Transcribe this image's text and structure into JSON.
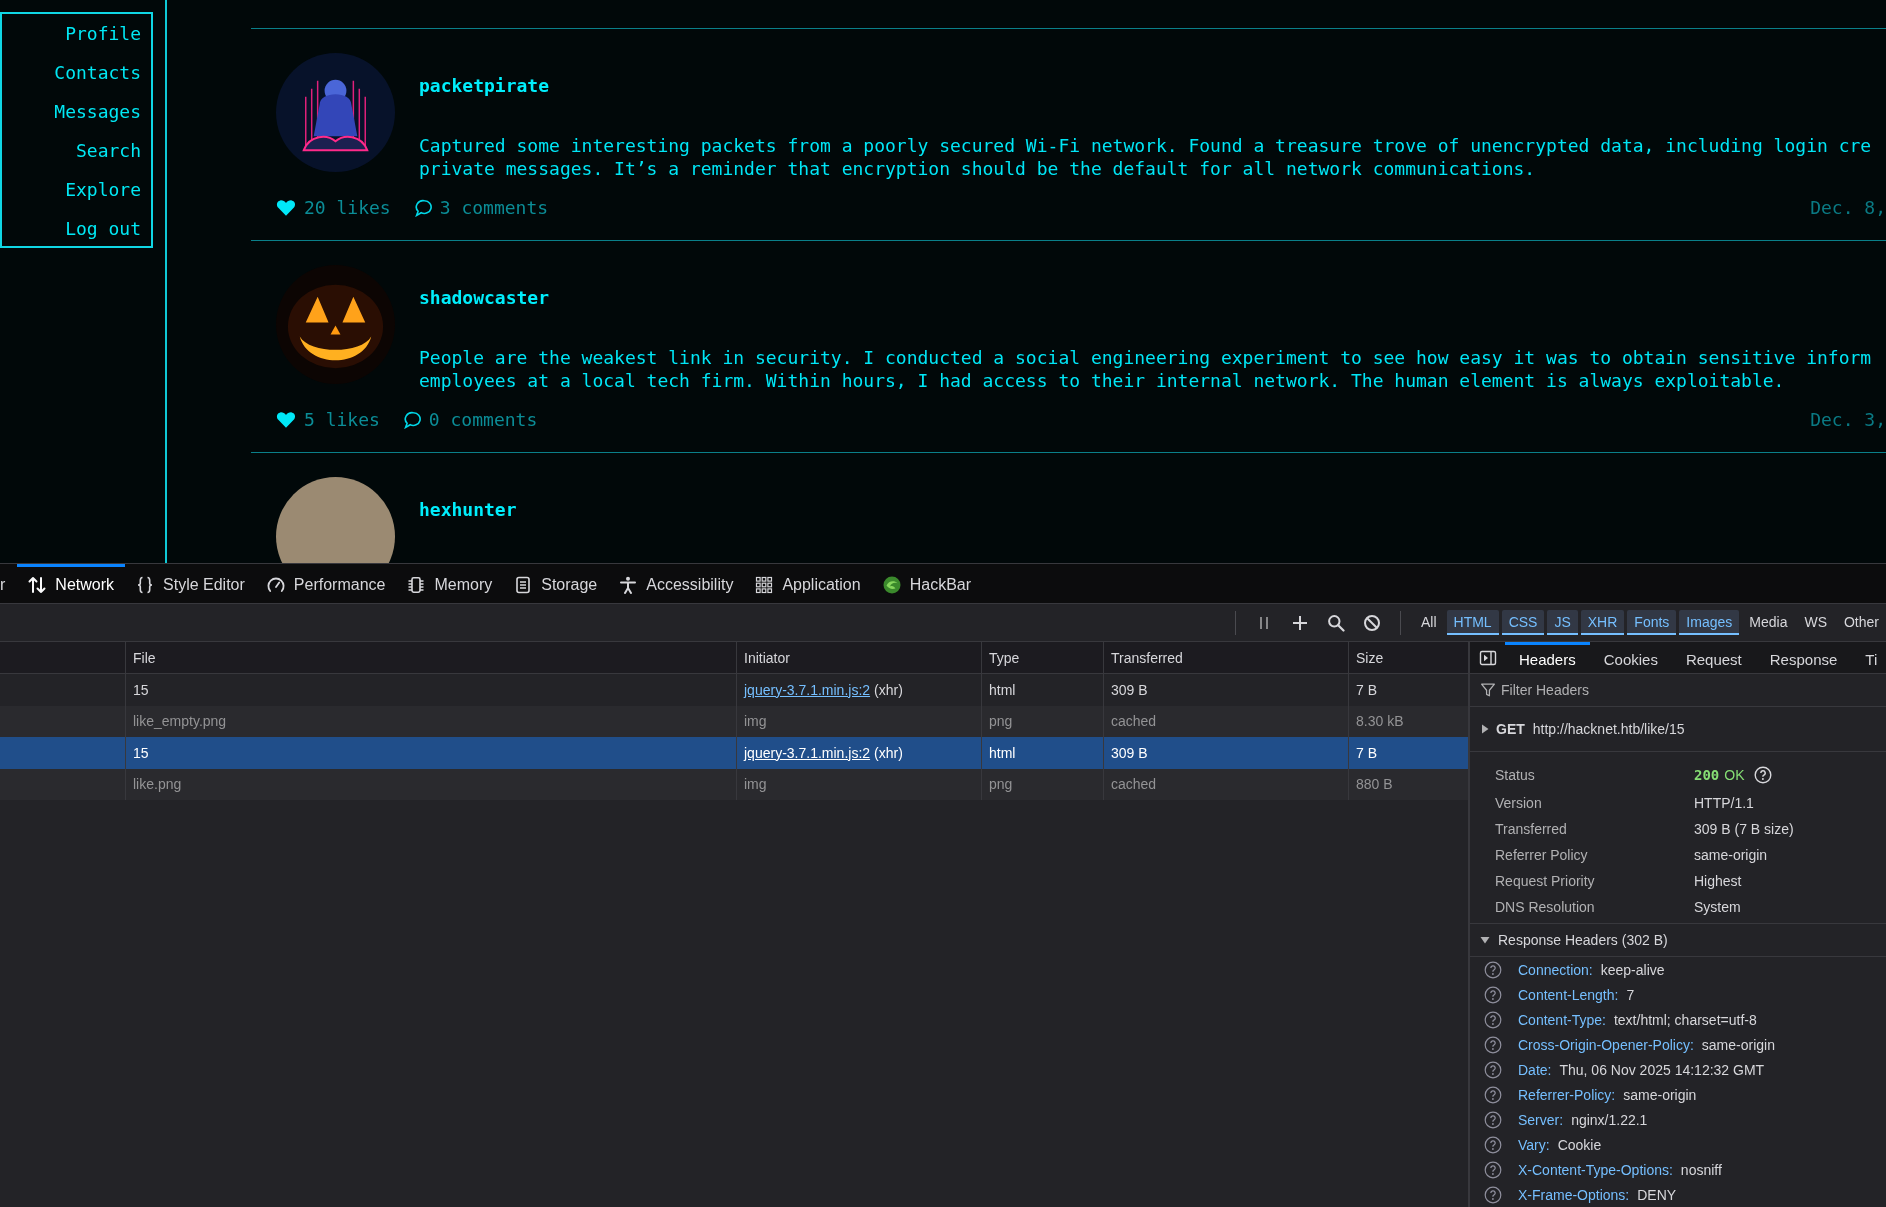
{
  "sidebar": {
    "items": [
      "Profile",
      "Contacts",
      "Messages",
      "Search",
      "Explore",
      "Log out"
    ]
  },
  "feed": {
    "posts": [
      {
        "avatar": {
          "kind": "silhouette"
        },
        "username": "packetpirate",
        "body": "Captured some interesting packets from a poorly secured Wi-Fi network. Found a treasure trove of unencrypted data, including login cre\nprivate messages. It’s a reminder that encryption should be the default for all network communications.",
        "likes": "20 likes",
        "comments": "3 comments",
        "date": "Dec. 8,"
      },
      {
        "avatar": {
          "kind": "pumpkin"
        },
        "username": "shadowcaster",
        "body": "People are the weakest link in security. I conducted a social engineering experiment to see how easy it was to obtain sensitive inform\nemployees at a local tech firm. Within hours, I had access to their internal network. The human element is always exploitable.",
        "likes": "5 likes",
        "comments": "0 comments",
        "date": "Dec. 3,"
      },
      {
        "avatar": {
          "kind": "photo"
        },
        "username": "hexhunter"
      }
    ]
  },
  "devtools": {
    "tabs": [
      {
        "kind": "plain",
        "label": "r",
        "selected": false
      },
      {
        "kind": "network",
        "label": "Network",
        "selected": true
      },
      {
        "kind": "styles",
        "label": "Style Editor",
        "selected": false
      },
      {
        "kind": "performance",
        "label": "Performance",
        "selected": false
      },
      {
        "kind": "memory",
        "label": "Memory",
        "selected": false
      },
      {
        "kind": "storage",
        "label": "Storage",
        "selected": false
      },
      {
        "kind": "accessibility",
        "label": "Accessibility",
        "selected": false
      },
      {
        "kind": "application",
        "label": "Application",
        "selected": false
      },
      {
        "kind": "addon",
        "label": "HackBar",
        "selected": false
      }
    ],
    "toolbar": {
      "filters": [
        {
          "label": "All",
          "selected": false
        },
        {
          "label": "HTML",
          "selected": true
        },
        {
          "label": "CSS",
          "selected": true
        },
        {
          "label": "JS",
          "selected": true
        },
        {
          "label": "XHR",
          "selected": true
        },
        {
          "label": "Fonts",
          "selected": true
        },
        {
          "label": "Images",
          "selected": true
        },
        {
          "label": "Media",
          "selected": false
        },
        {
          "label": "WS",
          "selected": false
        },
        {
          "label": "Other",
          "selected": false
        }
      ]
    },
    "requests": {
      "columns": [
        "File",
        "Initiator",
        "Type",
        "Transferred",
        "Size"
      ],
      "rows": [
        {
          "file": "15",
          "initiator": {
            "link": "jquery-3.7.1.min.js:2",
            "text": "(xhr)"
          },
          "type": "html",
          "transferred": "309 B",
          "size": "7 B",
          "cached": false,
          "selected": false
        },
        {
          "file": "like_empty.png",
          "initiator": {
            "text": "img"
          },
          "type": "png",
          "transferred": "cached",
          "size": "8.30 kB",
          "cached": true,
          "selected": false
        },
        {
          "file": "15",
          "initiator": {
            "link": "jquery-3.7.1.min.js:2",
            "text": "(xhr)"
          },
          "type": "html",
          "transferred": "309 B",
          "size": "7 B",
          "cached": false,
          "selected": true
        },
        {
          "file": "like.png",
          "initiator": {
            "text": "img"
          },
          "type": "png",
          "transferred": "cached",
          "size": "880 B",
          "cached": true,
          "selected": false
        }
      ]
    },
    "details": {
      "tabs": [
        {
          "label": "Headers",
          "selected": true
        },
        {
          "label": "Cookies",
          "selected": false
        },
        {
          "label": "Request",
          "selected": false
        },
        {
          "label": "Response",
          "selected": false
        },
        {
          "label": "Ti",
          "selected": false
        }
      ],
      "filter": {
        "placeholder": "Filter Headers"
      },
      "request": {
        "method": "GET",
        "url": "http://hacknet.htb/like/15",
        "expanded": false
      },
      "summary": [
        {
          "kind": "status",
          "label": "Status",
          "code": "200",
          "text": "OK"
        },
        {
          "kind": "text",
          "label": "Version",
          "value": "HTTP/1.1"
        },
        {
          "kind": "text",
          "label": "Transferred",
          "value": "309 B (7 B size)"
        },
        {
          "kind": "text",
          "label": "Referrer Policy",
          "value": "same-origin"
        },
        {
          "kind": "text",
          "label": "Request Priority",
          "value": "Highest"
        },
        {
          "kind": "text",
          "label": "DNS Resolution",
          "value": "System"
        }
      ],
      "response_headers": {
        "title": "Response Headers (302 B)",
        "expanded": true,
        "items": [
          {
            "name": "Connection:",
            "value": "keep-alive"
          },
          {
            "name": "Content-Length:",
            "value": "7"
          },
          {
            "name": "Content-Type:",
            "value": "text/html; charset=utf-8"
          },
          {
            "name": "Cross-Origin-Opener-Policy:",
            "value": "same-origin"
          },
          {
            "name": "Date:",
            "value": "Thu, 06 Nov 2025 14:12:32 GMT"
          },
          {
            "name": "Referrer-Policy:",
            "value": "same-origin"
          },
          {
            "name": "Server:",
            "value": "nginx/1.22.1"
          },
          {
            "name": "Vary:",
            "value": "Cookie"
          },
          {
            "name": "X-Content-Type-Options:",
            "value": "nosniff"
          },
          {
            "name": "X-Frame-Options:",
            "value": "DENY"
          }
        ]
      }
    }
  }
}
